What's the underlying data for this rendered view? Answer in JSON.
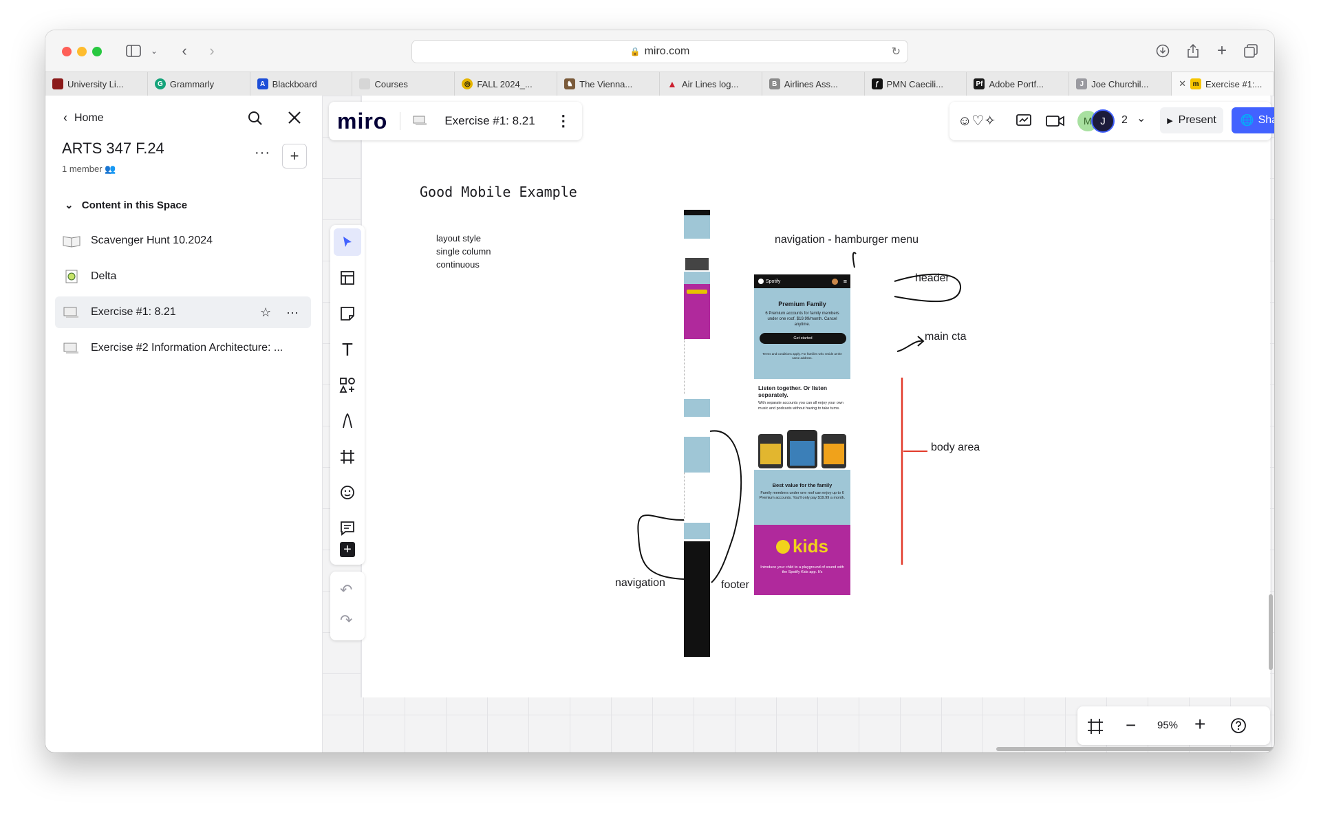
{
  "browser": {
    "url": "miro.com",
    "tabs": [
      {
        "label": "University Li...",
        "color": "#8b1a1a"
      },
      {
        "label": "Grammarly",
        "color": "#15a37a"
      },
      {
        "label": "Blackboard",
        "color": "#1d4ed8"
      },
      {
        "label": "Courses",
        "color": "#c9c9c9"
      },
      {
        "label": "FALL 2024_...",
        "color": "#e5b400"
      },
      {
        "label": "The Vienna...",
        "color": "#7a5a3a"
      },
      {
        "label": "Air Lines log...",
        "color": "#cc1f2f"
      },
      {
        "label": "Airlines Ass...",
        "color": "#8a8a8a"
      },
      {
        "label": "PMN Caecili...",
        "color": "#111111"
      },
      {
        "label": "Adobe Portf...",
        "color": "#1a1a1a"
      },
      {
        "label": "Joe Churchil...",
        "color": "#9a9aa0"
      },
      {
        "label": "Exercise #1:...",
        "color": "#f5c400"
      }
    ]
  },
  "sidebar": {
    "home_label": "Home",
    "space_title": "ARTS 347 F.24",
    "member_count": "1 member",
    "section_title": "Content in this Space",
    "items": [
      {
        "label": "Scavenger Hunt 10.2024"
      },
      {
        "label": "Delta"
      },
      {
        "label": "Exercise #1: 8.21"
      },
      {
        "label": "Exercise #2 Information Architecture: ..."
      }
    ]
  },
  "board": {
    "logo": "miro",
    "title": "Exercise #1: 8.21",
    "collaborators": [
      "M",
      "J"
    ],
    "collaborator_count": "2",
    "present_label": "Present",
    "share_label": "Share",
    "zoom": "95%"
  },
  "canvas": {
    "heading": "Good Mobile Example",
    "note_lines": [
      "layout style",
      "single column",
      "continuous"
    ],
    "annotations": {
      "nav_hamburger": "navigation - hamburger menu",
      "header": "header",
      "main_cta": "main cta",
      "body_area": "body area",
      "navigation": "navigation",
      "footer": "footer"
    },
    "phone": {
      "brand": "Spotify",
      "hero_title": "Premium Family",
      "hero_text": "6 Premium accounts for family members under one roof. $19.99/month. Cancel anytime.",
      "cta": "Get started",
      "terms": "Terms and conditions apply. For families who reside at the same address.",
      "listen_title": "Listen together. Or listen separately.",
      "listen_text": "With separate accounts you can all enjoy your own music and podcasts without having to take turns.",
      "value_title": "Best value for the family",
      "value_text": "Family members under one roof can enjoy up to 6 Premium accounts. You'll only pay $19.99 a month.",
      "kids": "kids",
      "kids_text": "Introduce your child to a playground of sound with the Spotify Kids app. It's"
    }
  },
  "colors": {
    "accent": "#4262ff",
    "hero_blue": "#9fc6d6",
    "kids_magenta": "#b0299c",
    "annotation_red": "#e23a2a"
  }
}
